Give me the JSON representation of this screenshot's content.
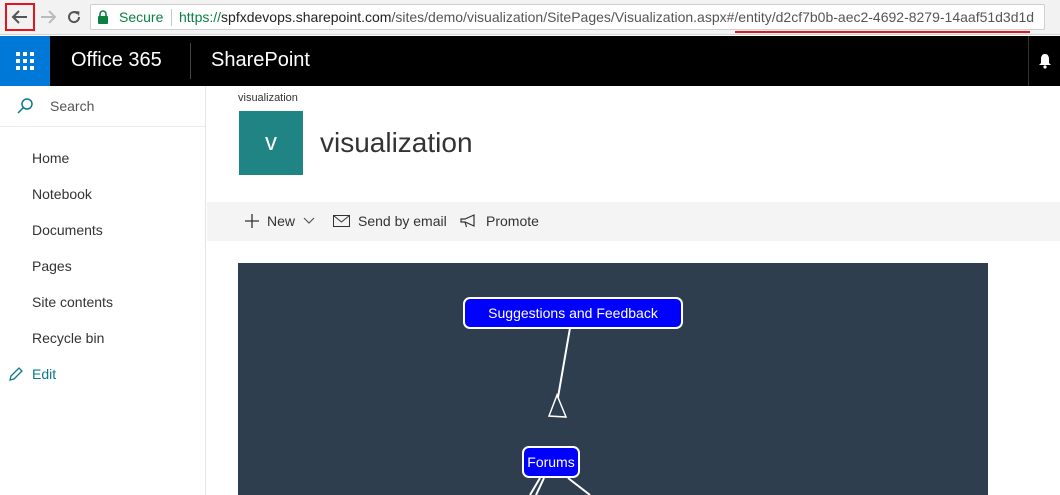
{
  "browser": {
    "secure_label": "Secure",
    "url_protocol": "https://",
    "url_host": "spfxdevops.sharepoint.com",
    "url_path": "/sites/demo/visualization/SitePages/Visualization.aspx#/entity/d2cf7b0b-aec2-4692-8279-14aaf51d3d1d",
    "highlight_color": "#e3161b"
  },
  "suitebar": {
    "app_launcher_icon": "waffle-icon",
    "product": "Office 365",
    "app": "SharePoint",
    "notifications_icon": "bell-icon",
    "accent": "#0078d7"
  },
  "leftnav": {
    "search_label": "Search",
    "items": [
      "Home",
      "Notebook",
      "Documents",
      "Pages",
      "Site contents",
      "Recycle bin"
    ],
    "edit_label": "Edit"
  },
  "site": {
    "breadcrumb": "visualization",
    "logo_letter": "v",
    "logo_color": "#1f8483",
    "title": "visualization"
  },
  "commands": {
    "new": "New",
    "send_by_email": "Send by email",
    "promote": "Promote"
  },
  "graph": {
    "background": "#2e3e4e",
    "node_color": "#0000ff",
    "nodes": [
      {
        "id": "suggestions",
        "label": "Suggestions and Feedback"
      },
      {
        "id": "forums",
        "label": "Forums"
      }
    ]
  }
}
